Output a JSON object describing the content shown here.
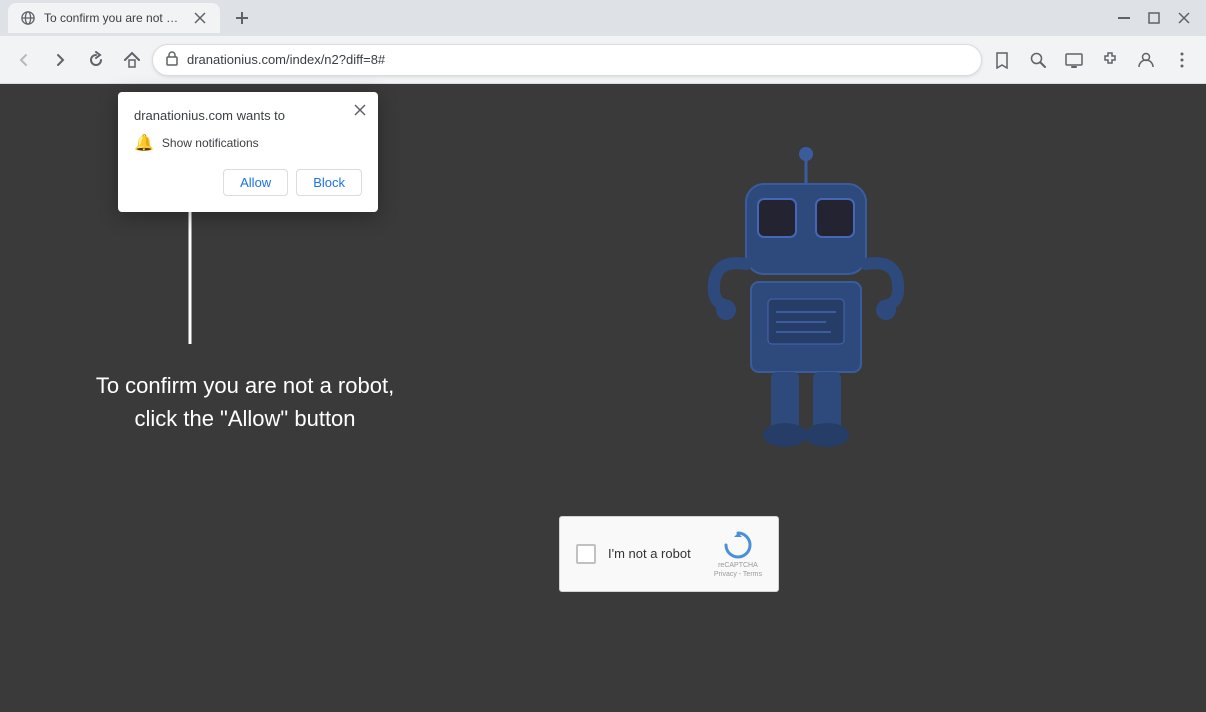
{
  "browser": {
    "tab": {
      "title": "To confirm you are not a robot,",
      "icon": "globe-icon"
    },
    "new_tab_label": "+",
    "controls": {
      "minimize": "─",
      "maximize": "□",
      "close": "✕"
    },
    "nav": {
      "back": "←",
      "forward": "→",
      "refresh": "↻",
      "home": "⌂",
      "url": "dranationius.com/index/n2?diff=8#",
      "url_display": "dranationius.com/index/n2?diff=8#"
    },
    "right_icons": {
      "bookmark": "☆",
      "zoom": "🔍",
      "cast": "📺",
      "extensions": "🧩",
      "profile": "👤",
      "menu": "⋮"
    }
  },
  "popup": {
    "title": "dranationius.com wants to",
    "permission_icon": "🔔",
    "permission_text": "Show notifications",
    "allow_label": "Allow",
    "block_label": "Block",
    "close_icon": "✕"
  },
  "page": {
    "background_color": "#3a3a3a",
    "main_text_line1": "To confirm you are not a robot,",
    "main_text_line2": "click the \"Allow\" button"
  },
  "captcha": {
    "checkbox_label": "I'm not a robot",
    "logo_text": "reCAPTCHA",
    "privacy_text": "Privacy - Terms"
  }
}
